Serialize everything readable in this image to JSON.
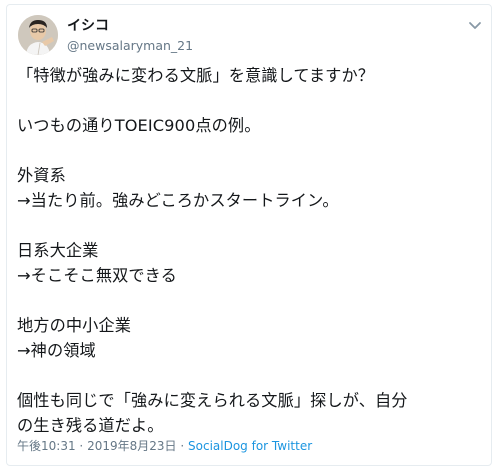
{
  "user": {
    "display_name": "イシコ",
    "handle": "@newsalaryman_21",
    "avatar_icon": "user-avatar-icon"
  },
  "menu_icon": "chevron-down-icon",
  "tweet": {
    "lines": [
      "「特徴が強みに変わる文脈」を意識してますか？",
      "",
      "いつもの通りTOEIC900点の例。",
      "",
      "外資系",
      "→当たり前。強みどころかスタートライン。",
      "",
      "日系大企業",
      "→そこそこ無双できる",
      "",
      "地方の中小企業",
      "→神の領域",
      "",
      "個性も同じで「強みに変えられる文脈」探しが、自分",
      "の生き残る道だよ。"
    ]
  },
  "meta": {
    "time": "午後10:31",
    "date": "2019年8月23日",
    "separator": "·",
    "source": "SocialDog for Twitter"
  },
  "colors": {
    "text": "#14171a",
    "secondary": "#657786",
    "link": "#1b95e0",
    "border": "#e6ecf0"
  }
}
